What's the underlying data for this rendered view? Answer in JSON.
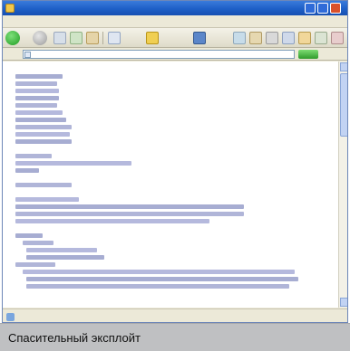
{
  "window": {
    "title": "",
    "menu": [
      "",
      "",
      "",
      "",
      "",
      ""
    ],
    "toolbar": {
      "back_label": "",
      "search_label": "",
      "favorites_label": "",
      "media_label": ""
    },
    "address": {
      "label": "",
      "value": ""
    },
    "status": ""
  },
  "code": {
    "lines": [
      "",
      "",
      "",
      "",
      "",
      "",
      "",
      "",
      "",
      "",
      "",
      "",
      "",
      "",
      "",
      "",
      "",
      "",
      "",
      "",
      "",
      "",
      "",
      "",
      "",
      "",
      "",
      "",
      "",
      "",
      "",
      ""
    ]
  },
  "caption": {
    "text": "Спасительный эксплойт"
  }
}
